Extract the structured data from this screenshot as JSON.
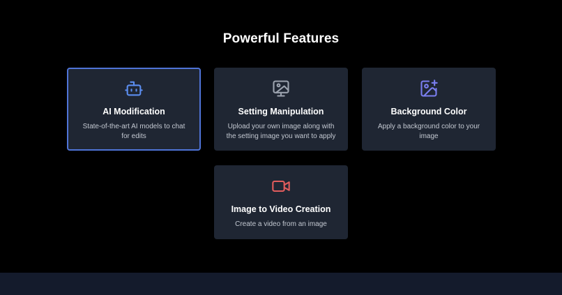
{
  "section": {
    "title": "Powerful Features"
  },
  "features": [
    {
      "title": "AI Modification",
      "description": "State-of-the-art AI models to chat for edits",
      "icon": "bot-icon",
      "color": "#5b8def"
    },
    {
      "title": "Setting Manipulation",
      "description": "Upload your own image along with the setting image you want to apply",
      "icon": "image-monitor-icon",
      "color": "#9ca3af"
    },
    {
      "title": "Background Color",
      "description": "Apply a background color to your image",
      "icon": "image-plus-icon",
      "color": "#7b7ff0"
    },
    {
      "title": "Image to Video Creation",
      "description": "Create a video from an image",
      "icon": "video-camera-icon",
      "color": "#e25d5d"
    }
  ],
  "colors": {
    "background": "#000000",
    "card": "#1f2633",
    "active_border": "#4f74d8",
    "footer": "#141b2c"
  }
}
